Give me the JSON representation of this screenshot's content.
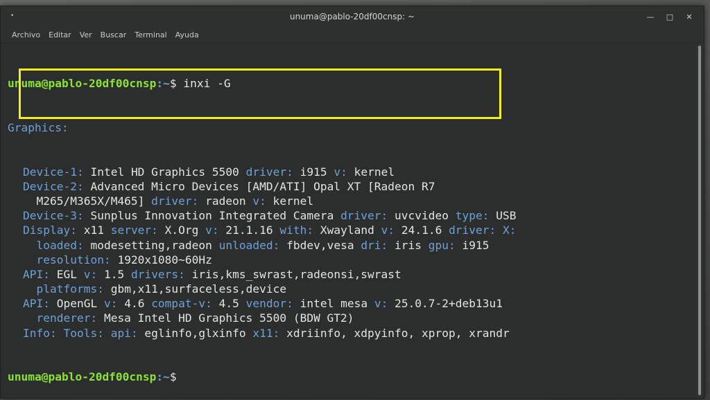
{
  "window": {
    "title": "unuma@pablo-20df00cnsp: ~",
    "menu": [
      "Archivo",
      "Editar",
      "Ver",
      "Buscar",
      "Terminal",
      "Ayuda"
    ],
    "pin_glyph": "•",
    "controls": [
      "—",
      "□",
      "✕"
    ]
  },
  "terminal": {
    "prompt_user": "unuma@pablo-20df00cnsp",
    "prompt_path": ":~",
    "prompt_symbol": "$",
    "command": " inxi -G",
    "section": "Graphics:",
    "lines": [
      [
        [
          "Device-1:",
          "k"
        ],
        [
          " Intel HD Graphics 5500 ",
          "v"
        ],
        [
          "driver:",
          "k"
        ],
        [
          " i915 ",
          "v"
        ],
        [
          "v:",
          "k"
        ],
        [
          " kernel",
          "v"
        ]
      ],
      [
        [
          "Device-2:",
          "k"
        ],
        [
          " Advanced Micro Devices [AMD/ATI] Opal XT [Radeon R7",
          "v"
        ]
      ],
      [
        [
          "  M265/M365X/M465] ",
          "v"
        ],
        [
          "driver:",
          "k"
        ],
        [
          " radeon ",
          "v"
        ],
        [
          "v:",
          "k"
        ],
        [
          " kernel",
          "v"
        ]
      ],
      [
        [
          "Device-3:",
          "k"
        ],
        [
          " Sunplus Innovation Integrated Camera ",
          "v"
        ],
        [
          "driver:",
          "k"
        ],
        [
          " uvcvideo ",
          "v"
        ],
        [
          "type:",
          "k"
        ],
        [
          " USB",
          "v"
        ]
      ],
      [
        [
          "Display:",
          "k"
        ],
        [
          " x11 ",
          "v"
        ],
        [
          "server:",
          "k"
        ],
        [
          " X.Org ",
          "v"
        ],
        [
          "v:",
          "k"
        ],
        [
          " 21.1.16 ",
          "v"
        ],
        [
          "with:",
          "k"
        ],
        [
          " Xwayland ",
          "v"
        ],
        [
          "v:",
          "k"
        ],
        [
          " 24.1.6 ",
          "v"
        ],
        [
          "driver:",
          "k"
        ],
        [
          " X:",
          "k"
        ]
      ],
      [
        [
          "  loaded:",
          "k"
        ],
        [
          " modesetting,radeon ",
          "v"
        ],
        [
          "unloaded:",
          "k"
        ],
        [
          " fbdev,vesa ",
          "v"
        ],
        [
          "dri:",
          "k"
        ],
        [
          " iris ",
          "v"
        ],
        [
          "gpu:",
          "k"
        ],
        [
          " i915",
          "v"
        ]
      ],
      [
        [
          "  resolution:",
          "k"
        ],
        [
          " 1920x1080~60Hz",
          "v"
        ]
      ],
      [
        [
          "API:",
          "k"
        ],
        [
          " EGL ",
          "v"
        ],
        [
          "v:",
          "k"
        ],
        [
          " 1.5 ",
          "v"
        ],
        [
          "drivers:",
          "k"
        ],
        [
          " iris,kms_swrast,radeonsi,swrast",
          "v"
        ]
      ],
      [
        [
          "  platforms:",
          "k"
        ],
        [
          " gbm,x11,surfaceless,device",
          "v"
        ]
      ],
      [
        [
          "API:",
          "k"
        ],
        [
          " OpenGL ",
          "v"
        ],
        [
          "v:",
          "k"
        ],
        [
          " 4.6 ",
          "v"
        ],
        [
          "compat-v:",
          "k"
        ],
        [
          " 4.5 ",
          "v"
        ],
        [
          "vendor:",
          "k"
        ],
        [
          " intel mesa ",
          "v"
        ],
        [
          "v:",
          "k"
        ],
        [
          " 25.0.7-2+deb13u1",
          "v"
        ]
      ],
      [
        [
          "  renderer:",
          "k"
        ],
        [
          " Mesa Intel HD Graphics 5500 (BDW GT2)",
          "v"
        ]
      ],
      [
        [
          "Info:",
          "k"
        ],
        [
          " Tools: ",
          "k"
        ],
        [
          "api:",
          "k"
        ],
        [
          " eglinfo,glxinfo ",
          "v"
        ],
        [
          "x11:",
          "k"
        ],
        [
          " xdriinfo, xdpyinfo, xprop, xrandr",
          "v"
        ]
      ]
    ]
  },
  "colors": {
    "prompt_user": "#8ae234",
    "prompt_path": "#729fcf",
    "key": "#6ea0d8",
    "value": "#e3e3e3",
    "highlight_box": "#f4ef14"
  }
}
